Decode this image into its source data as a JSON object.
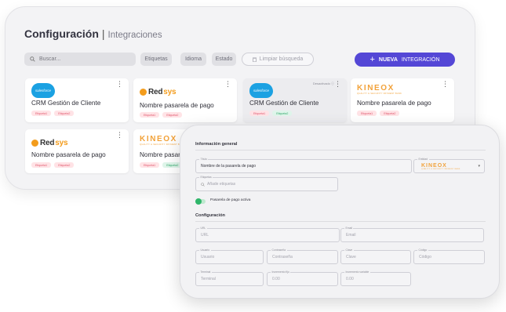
{
  "header": {
    "title": "Configuración",
    "separator": "|",
    "subtitle": "Integraciones"
  },
  "toolbar": {
    "search_placeholder": "Buscar...",
    "filters": [
      "Etiquetas",
      "Idioma",
      "Estado"
    ],
    "clear_label": "Limpiar búsqueda",
    "new_plus": "+",
    "new_label_bold": "NUEVA",
    "new_label": "INTEGRACIÓN",
    "accent": "#5447d6"
  },
  "cards": [
    {
      "logo": "salesforce",
      "logo_text": "salesforce",
      "name": "CRM Gestión de Cliente",
      "tags": [
        "Etiqueta1",
        "Etiqueta2"
      ]
    },
    {
      "logo": "redsys",
      "logo_red": "Red",
      "logo_sys": "sys",
      "name": "Nombre pasarela de pago",
      "tags": [
        "Etiqueta1",
        "Etiqueta2"
      ]
    },
    {
      "logo": "salesforce",
      "logo_text": "salesforce",
      "name": "CRM Gestión de Cliente",
      "status": "Desactivado",
      "tags": [
        "Etiqueta1",
        "Etiqueta2"
      ]
    },
    {
      "logo": "kineox",
      "logo_text": "KINEOX",
      "logo_sub": "QUALITY & SECURITY PAYMENT BANK",
      "name": "Nombre pasarela de pago",
      "tags": [
        "Etiqueta1",
        "Etiqueta2"
      ]
    },
    {
      "logo": "redsys",
      "logo_red": "Red",
      "logo_sys": "sys",
      "name": "Nombre pasarela de pago",
      "tags": [
        "Etiqueta1",
        "Etiqueta2"
      ]
    },
    {
      "logo": "kineox",
      "logo_text": "KINEOX",
      "logo_sub": "QUALITY & SECURITY PAYMENT BANK",
      "name": "Nombre pasarela de pago",
      "tags": [
        "Etiqueta1",
        "Etiqueta2"
      ]
    }
  ],
  "form": {
    "general_title": "Información general",
    "titulo_label": "Título",
    "titulo_value": "Nombre de la pasarela de pago",
    "entidad_label": "Entidad",
    "entidad_value": "KINEOX",
    "entidad_sub": "QUALITY & SECURITY PAYMENT BANK",
    "etiquetas_label": "Etiquetas",
    "etiquetas_placeholder": "Añade etiquetas",
    "active_label": "Pasarela de pago activa",
    "config_title": "Configuración",
    "url_label": "URL",
    "url_placeholder": "URL",
    "email_label": "Email",
    "email_placeholder": "Email",
    "usuario_label": "Usuario",
    "usuario_placeholder": "Usuario",
    "contrasena_label": "Contraseña",
    "contrasena_placeholder": "Contraseña",
    "clave_label": "Clave",
    "clave_placeholder": "Clave",
    "codigo_label": "Código",
    "codigo_placeholder": "Código",
    "terminal_label": "Terminal",
    "terminal_placeholder": "Terminal",
    "inc_fijo_label": "Incremento fijo",
    "inc_fijo_value": "0.00",
    "inc_var_label": "Incremento variable",
    "inc_var_value": "0.00"
  }
}
